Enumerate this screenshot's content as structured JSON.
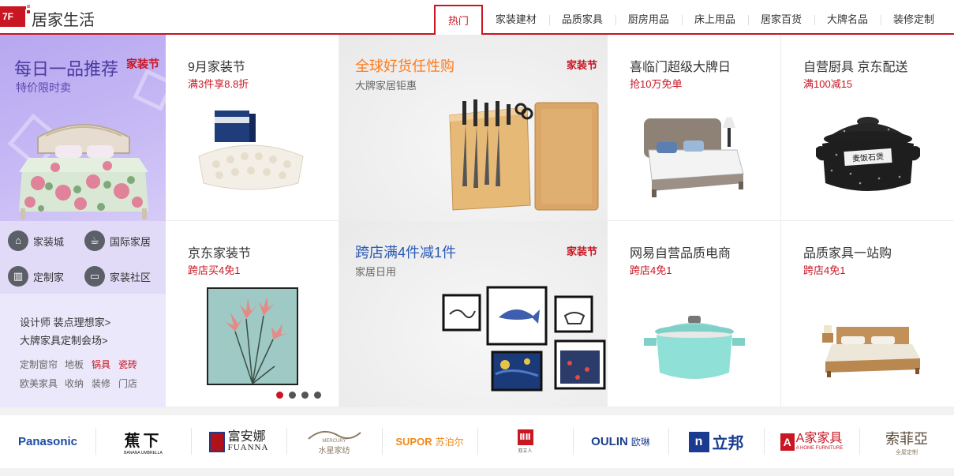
{
  "header": {
    "floor_badge": "7F",
    "title": "居家生活",
    "tabs": [
      "热门",
      "家装建材",
      "品质家具",
      "厨房用品",
      "床上用品",
      "居家百货",
      "大牌名品",
      "装修定制"
    ]
  },
  "promo": {
    "title": "每日一品推荐",
    "tag": "家装节",
    "subtitle": "特价限时卖"
  },
  "icon_links": [
    {
      "label": "家装城",
      "icon": "lamp-icon"
    },
    {
      "label": "国际家居",
      "icon": "cup-icon"
    },
    {
      "label": "定制家",
      "icon": "cabinet-icon"
    },
    {
      "label": "家装社区",
      "icon": "sofa-icon"
    }
  ],
  "text_links": {
    "main": [
      "设计师 装点理想家>",
      "大牌家具定制会场>"
    ],
    "row1": [
      "定制窗帘",
      "地板",
      "锅具",
      "瓷砖"
    ],
    "row2": [
      "欧美家具",
      "收纳",
      "装修",
      "门店"
    ]
  },
  "cells": {
    "c1": {
      "title": "9月家装节",
      "sub": "满3件享8.8折"
    },
    "c2": {
      "title": "全球好货任性购",
      "sub": "大牌家居钜惠",
      "tag": "家装节"
    },
    "c3": {
      "title": "喜临门超级大牌日",
      "sub": "抢10万免单"
    },
    "c4": {
      "title": "自营厨具 京东配送",
      "sub": "满100减15"
    },
    "c5": {
      "title": "京东家装节",
      "sub": "跨店买4免1"
    },
    "c6": {
      "title": "跨店满4件减1件",
      "sub": "家居日用",
      "tag": "家装节"
    },
    "c7": {
      "title": "网易自营品质电商",
      "sub": "跨店4免1"
    },
    "c8": {
      "title": "品质家具一站购",
      "sub": "跨店4免1"
    },
    "pot_label": "麦饭石煲"
  },
  "carousel": {
    "count": 4,
    "active": 0
  },
  "brands": [
    "Panasonic",
    "蕉下",
    "BANANA UMBRELLA",
    "富安娜",
    "FUANNA",
    "水星家纺",
    "MERCURY",
    "SUPOR",
    "苏泊尔",
    "双立人",
    "OULIN",
    "欧琳",
    "立邦",
    "A家家具",
    "A HOME FURNITURE",
    "索菲亞",
    "全屋定制"
  ],
  "colors": {
    "accent": "#c81623",
    "promo_bg": "#b7a7f0",
    "blue_title": "#2a58b5",
    "orange_title": "#ff7a1a"
  }
}
